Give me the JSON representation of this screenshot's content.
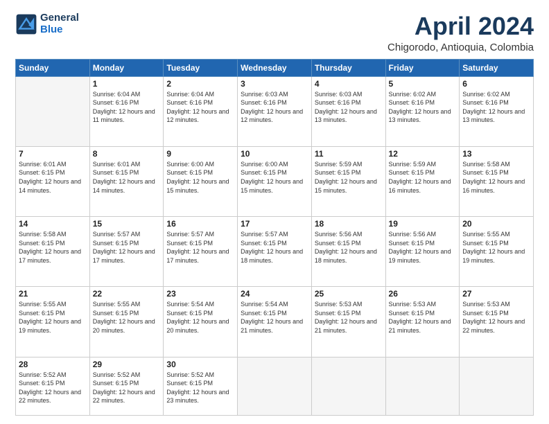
{
  "logo": {
    "line1": "General",
    "line2": "Blue"
  },
  "title": "April 2024",
  "location": "Chigorodo, Antioquia, Colombia",
  "days_of_week": [
    "Sunday",
    "Monday",
    "Tuesday",
    "Wednesday",
    "Thursday",
    "Friday",
    "Saturday"
  ],
  "weeks": [
    [
      {
        "day": "",
        "empty": true
      },
      {
        "day": "1",
        "sunrise": "6:04 AM",
        "sunset": "6:16 PM",
        "daylight": "12 hours and 11 minutes."
      },
      {
        "day": "2",
        "sunrise": "6:04 AM",
        "sunset": "6:16 PM",
        "daylight": "12 hours and 12 minutes."
      },
      {
        "day": "3",
        "sunrise": "6:03 AM",
        "sunset": "6:16 PM",
        "daylight": "12 hours and 12 minutes."
      },
      {
        "day": "4",
        "sunrise": "6:03 AM",
        "sunset": "6:16 PM",
        "daylight": "12 hours and 13 minutes."
      },
      {
        "day": "5",
        "sunrise": "6:02 AM",
        "sunset": "6:16 PM",
        "daylight": "12 hours and 13 minutes."
      },
      {
        "day": "6",
        "sunrise": "6:02 AM",
        "sunset": "6:16 PM",
        "daylight": "12 hours and 13 minutes."
      }
    ],
    [
      {
        "day": "7",
        "sunrise": "6:01 AM",
        "sunset": "6:15 PM",
        "daylight": "12 hours and 14 minutes."
      },
      {
        "day": "8",
        "sunrise": "6:01 AM",
        "sunset": "6:15 PM",
        "daylight": "12 hours and 14 minutes."
      },
      {
        "day": "9",
        "sunrise": "6:00 AM",
        "sunset": "6:15 PM",
        "daylight": "12 hours and 15 minutes."
      },
      {
        "day": "10",
        "sunrise": "6:00 AM",
        "sunset": "6:15 PM",
        "daylight": "12 hours and 15 minutes."
      },
      {
        "day": "11",
        "sunrise": "5:59 AM",
        "sunset": "6:15 PM",
        "daylight": "12 hours and 15 minutes."
      },
      {
        "day": "12",
        "sunrise": "5:59 AM",
        "sunset": "6:15 PM",
        "daylight": "12 hours and 16 minutes."
      },
      {
        "day": "13",
        "sunrise": "5:58 AM",
        "sunset": "6:15 PM",
        "daylight": "12 hours and 16 minutes."
      }
    ],
    [
      {
        "day": "14",
        "sunrise": "5:58 AM",
        "sunset": "6:15 PM",
        "daylight": "12 hours and 17 minutes."
      },
      {
        "day": "15",
        "sunrise": "5:57 AM",
        "sunset": "6:15 PM",
        "daylight": "12 hours and 17 minutes."
      },
      {
        "day": "16",
        "sunrise": "5:57 AM",
        "sunset": "6:15 PM",
        "daylight": "12 hours and 17 minutes."
      },
      {
        "day": "17",
        "sunrise": "5:57 AM",
        "sunset": "6:15 PM",
        "daylight": "12 hours and 18 minutes."
      },
      {
        "day": "18",
        "sunrise": "5:56 AM",
        "sunset": "6:15 PM",
        "daylight": "12 hours and 18 minutes."
      },
      {
        "day": "19",
        "sunrise": "5:56 AM",
        "sunset": "6:15 PM",
        "daylight": "12 hours and 19 minutes."
      },
      {
        "day": "20",
        "sunrise": "5:55 AM",
        "sunset": "6:15 PM",
        "daylight": "12 hours and 19 minutes."
      }
    ],
    [
      {
        "day": "21",
        "sunrise": "5:55 AM",
        "sunset": "6:15 PM",
        "daylight": "12 hours and 19 minutes."
      },
      {
        "day": "22",
        "sunrise": "5:55 AM",
        "sunset": "6:15 PM",
        "daylight": "12 hours and 20 minutes."
      },
      {
        "day": "23",
        "sunrise": "5:54 AM",
        "sunset": "6:15 PM",
        "daylight": "12 hours and 20 minutes."
      },
      {
        "day": "24",
        "sunrise": "5:54 AM",
        "sunset": "6:15 PM",
        "daylight": "12 hours and 21 minutes."
      },
      {
        "day": "25",
        "sunrise": "5:53 AM",
        "sunset": "6:15 PM",
        "daylight": "12 hours and 21 minutes."
      },
      {
        "day": "26",
        "sunrise": "5:53 AM",
        "sunset": "6:15 PM",
        "daylight": "12 hours and 21 minutes."
      },
      {
        "day": "27",
        "sunrise": "5:53 AM",
        "sunset": "6:15 PM",
        "daylight": "12 hours and 22 minutes."
      }
    ],
    [
      {
        "day": "28",
        "sunrise": "5:52 AM",
        "sunset": "6:15 PM",
        "daylight": "12 hours and 22 minutes."
      },
      {
        "day": "29",
        "sunrise": "5:52 AM",
        "sunset": "6:15 PM",
        "daylight": "12 hours and 22 minutes."
      },
      {
        "day": "30",
        "sunrise": "5:52 AM",
        "sunset": "6:15 PM",
        "daylight": "12 hours and 23 minutes."
      },
      {
        "day": "",
        "empty": true
      },
      {
        "day": "",
        "empty": true
      },
      {
        "day": "",
        "empty": true
      },
      {
        "day": "",
        "empty": true
      }
    ]
  ]
}
